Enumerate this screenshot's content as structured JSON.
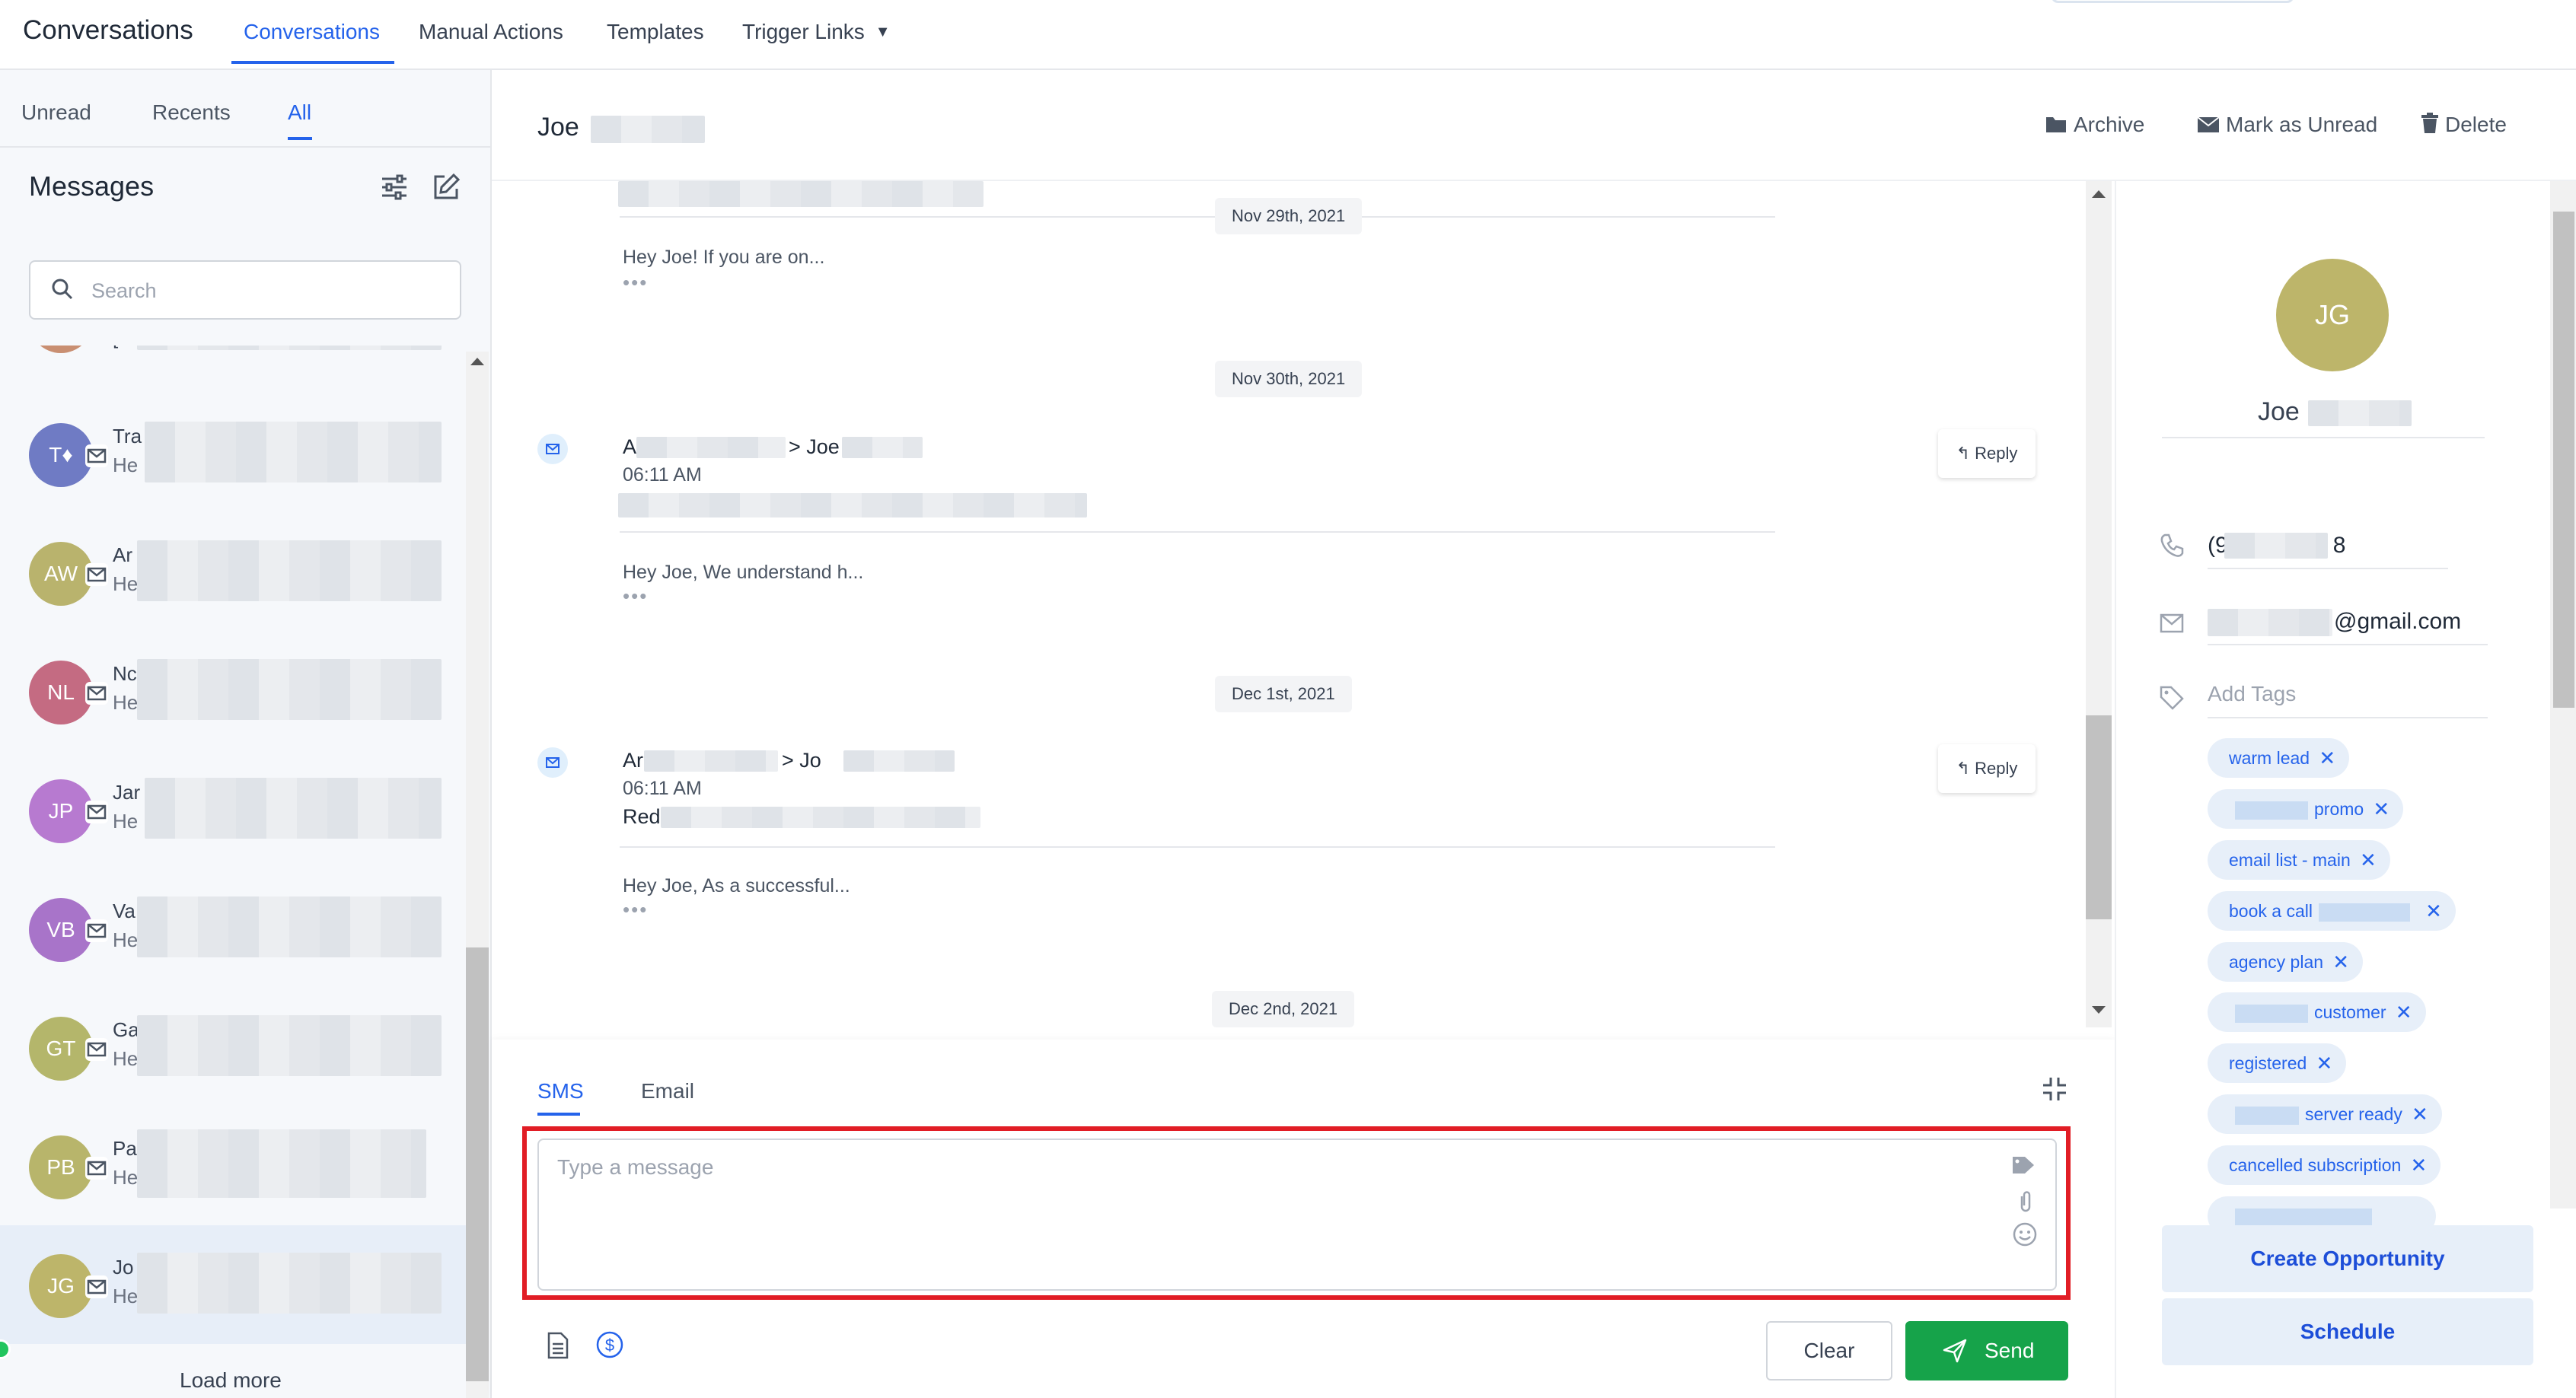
{
  "app": {
    "title": "Conversations",
    "nav": [
      "Conversations",
      "Manual Actions",
      "Templates",
      "Trigger Links"
    ]
  },
  "sidebar": {
    "filters": [
      "Unread",
      "Recents",
      "All"
    ],
    "active_filter": "All",
    "heading": "Messages",
    "search_placeholder": "Search",
    "conversations": [
      {
        "initials": "",
        "name": "[m",
        "preview": ""
      },
      {
        "initials": "T",
        "name": "Tra",
        "preview": "He",
        "color": "#6f7bc4"
      },
      {
        "initials": "AW",
        "name": "Ar",
        "preview": "He",
        "color": "#b9b36d"
      },
      {
        "initials": "NL",
        "name": "Nc",
        "preview": "He",
        "color": "#c46b82"
      },
      {
        "initials": "JP",
        "name": "Jar",
        "preview": "He",
        "color": "#b77ad0"
      },
      {
        "initials": "VB",
        "name": "Va",
        "preview": "He",
        "color": "#a874c9"
      },
      {
        "initials": "GT",
        "name": "Ga",
        "preview": "He",
        "color": "#b4b66b"
      },
      {
        "initials": "PB",
        "name": "Pa",
        "preview": "He",
        "color": "#b8b56b"
      },
      {
        "initials": "JG",
        "name": "Jo",
        "preview": "He",
        "color": "#bdb56a",
        "selected": true
      }
    ],
    "load_more": "Load more"
  },
  "conversation": {
    "contact_name": "Joe",
    "actions": [
      "Archive",
      "Mark as Unread",
      "Delete"
    ],
    "messages": [
      {
        "date": "Nov 29th, 2021",
        "snippet": "Hey Joe! If you are on...",
        "dots": "•••"
      },
      {
        "date": "Nov 30th, 2021",
        "from_prefix": "A",
        "to": "> Joe",
        "time": "06:11 AM",
        "snippet": "Hey Joe, We understand h...",
        "reply": "Reply",
        "dots": "•••"
      },
      {
        "date": "Dec 1st, 2021",
        "from_prefix": "Ar",
        "to": "> Jo",
        "time": "06:11 AM",
        "subject": "Red",
        "snippet": "Hey Joe, As a successful...",
        "reply": "Reply",
        "dots": "•••"
      },
      {
        "date": "Dec 2nd, 2021"
      }
    ]
  },
  "composer": {
    "tabs": [
      "SMS",
      "Email"
    ],
    "active_tab": "SMS",
    "placeholder": "Type a message",
    "clear_label": "Clear",
    "send_label": "Send"
  },
  "contact_panel": {
    "initials": "JG",
    "name": "Joe",
    "phone_start": "(9",
    "phone_end": "8",
    "email_suffix": "@gmail.com",
    "tags_placeholder": "Add Tags",
    "tags": [
      {
        "label": "warm lead"
      },
      {
        "label": "promo",
        "blur_before": true
      },
      {
        "label": "email list - main"
      },
      {
        "label": "book a call",
        "blur_after": true
      },
      {
        "label": "agency plan"
      },
      {
        "label": "customer",
        "blur_before": true
      },
      {
        "label": "registered"
      },
      {
        "label": "server ready",
        "blur_before": true
      },
      {
        "label": "cancelled subscription"
      }
    ],
    "create_opportunity": "Create Opportunity",
    "schedule": "Schedule"
  },
  "colors": {
    "accent": "#2563eb",
    "send_green": "#16a34a",
    "highlight_red": "#e11d25",
    "tag_bg": "#e7eff9"
  }
}
